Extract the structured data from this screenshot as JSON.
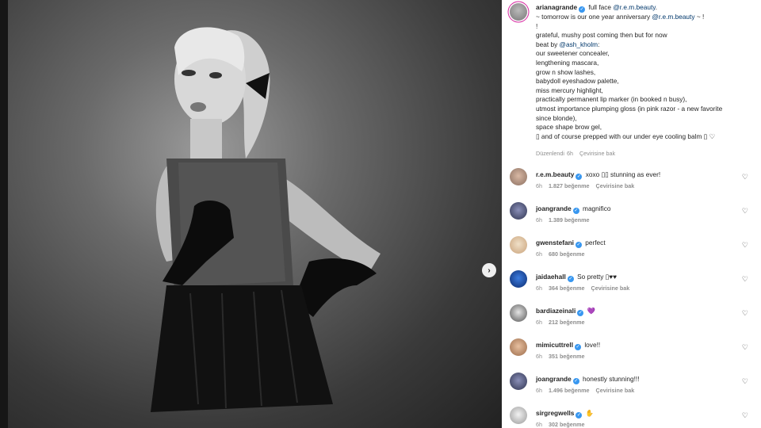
{
  "post": {
    "username": "arianagrande",
    "caption_first": "full face ",
    "caption_first_mention": "@r.e.m.beauty",
    "caption_first_end": ".",
    "line2_start": "~ tomorrow is our one year anniversary ",
    "line2_mention": "@r.e.m.beauty",
    "line2_end": " ~ !",
    "line3": "!",
    "line4": "grateful, mushy post coming then but for now",
    "line5_start": "beat by ",
    "line5_mention": "@ash_kholm",
    "line5_end": ":",
    "lines": [
      "our sweetener concealer,",
      "lengthening mascara,",
      "grow n show lashes,",
      "babydoll eyeshadow palette,",
      "miss mercury highlight,",
      "practically permanent lip marker (in booked n busy),",
      "utmost importance plumping gloss (in pink razor - a new favorite",
      "since blonde),",
      "space shape brow gel,",
      "▯ and of course prepped with our under eye cooling balm ▯ ♡"
    ],
    "edited_label": "Düzenlendi",
    "time": "6h",
    "translate": "Çevirisine bak"
  },
  "comments": [
    {
      "user": "r.e.m.beauty",
      "text": "xoxo ▯▯ stunning as ever!",
      "time": "6h",
      "likes": "1.827 beğenme",
      "translate": "Çevirisine bak"
    },
    {
      "user": "joangrande",
      "text": "magnifico",
      "time": "6h",
      "likes": "1.389 beğenme",
      "translate": ""
    },
    {
      "user": "gwenstefani",
      "text": "perfect",
      "time": "6h",
      "likes": "680 beğenme",
      "translate": ""
    },
    {
      "user": "jaidaehall",
      "text": "So pretty ▯♥♥",
      "time": "6h",
      "likes": "364 beğenme",
      "translate": "Çevirisine bak"
    },
    {
      "user": "bardiazeinali",
      "text": "💜",
      "time": "6h",
      "likes": "212 beğenme",
      "translate": ""
    },
    {
      "user": "mimicuttrell",
      "text": "love!!",
      "time": "6h",
      "likes": "351 beğenme",
      "translate": ""
    },
    {
      "user": "joangrande",
      "text": "honestly stunning!!!",
      "time": "6h",
      "likes": "1.496 beğenme",
      "translate": "Çevirisine bak"
    },
    {
      "user": "sirgregwells",
      "text": "✋",
      "time": "6h",
      "likes": "302 beğenme",
      "translate": ""
    }
  ],
  "icons": {
    "verified": "✓",
    "next": "›",
    "heart": "♡"
  },
  "colors": {
    "verified": "#3897f0",
    "mention": "#00376b",
    "meta": "#8e8e8e"
  }
}
